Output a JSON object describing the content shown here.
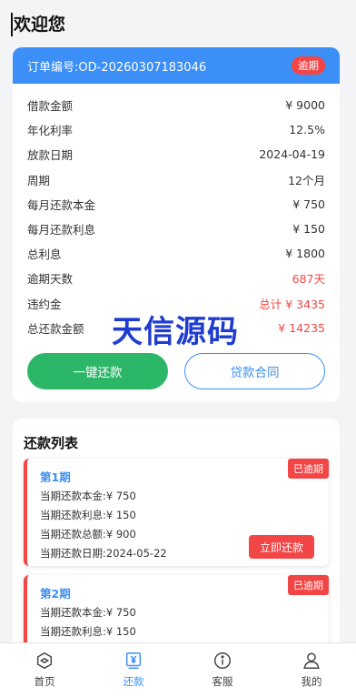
{
  "page": {
    "title": "欢迎您"
  },
  "loan": {
    "order_label": "订单编号:OD-20260307183046",
    "status_tag": "逾期",
    "details": [
      {
        "label": "借款金额",
        "value": "¥ 9000",
        "highlight": false
      },
      {
        "label": "年化利率",
        "value": "12.5%",
        "highlight": false
      },
      {
        "label": "放款日期",
        "value": "2024-04-19",
        "highlight": false
      },
      {
        "label": "周期",
        "value": "12个月",
        "highlight": false
      },
      {
        "label": "每月还款本金",
        "value": "¥ 750",
        "highlight": false
      },
      {
        "label": "每月还款利息",
        "value": "¥ 150",
        "highlight": false
      },
      {
        "label": "总利息",
        "value": "¥ 1800",
        "highlight": false
      },
      {
        "label": "逾期天数",
        "value": "687天",
        "highlight": true
      },
      {
        "label": "违约金",
        "value": "总计 ¥ 3435",
        "highlight": true
      },
      {
        "label": "总还款金额",
        "value": "¥ 14235",
        "highlight": true
      }
    ],
    "repay_button": "一键还款",
    "contract_button": "贷款合同"
  },
  "watermark": "天信源码",
  "repayments": {
    "title": "还款列表",
    "items": [
      {
        "period": "第1期",
        "status": "已逾期",
        "principal": "当期还款本金:¥ 750",
        "interest": "当期还款利息:¥ 150",
        "total": "当期还款总额:¥ 900",
        "date": "当期还款日期:2024-05-22",
        "pay_button": "立即还款"
      },
      {
        "period": "第2期",
        "status": "已逾期",
        "principal": "当期还款本金:¥ 750",
        "interest": "当期还款利息:¥ 150"
      }
    ]
  },
  "tabbar": [
    {
      "label": "首页",
      "icon": "home-icon",
      "active": false
    },
    {
      "label": "还款",
      "icon": "yen-icon",
      "active": true
    },
    {
      "label": "客服",
      "icon": "info-icon",
      "active": false
    },
    {
      "label": "我的",
      "icon": "user-icon",
      "active": false
    }
  ],
  "colors": {
    "accent": "#3b8ff7",
    "danger": "#f24545",
    "success": "#2bb767"
  }
}
